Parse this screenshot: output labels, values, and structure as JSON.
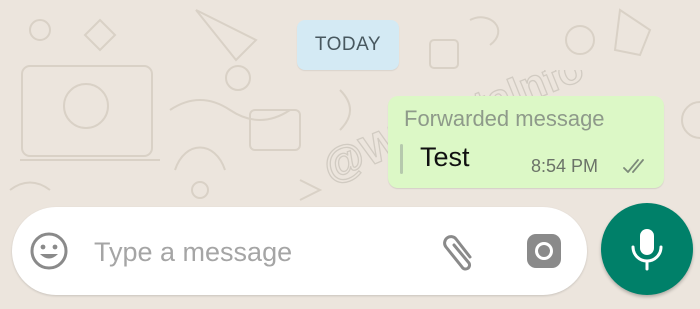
{
  "chat": {
    "date_divider": "TODAY",
    "message": {
      "forwarded_label": "Forwarded message",
      "text": "Test",
      "time": "8:54 PM",
      "status": "sent-double-tick"
    }
  },
  "composer": {
    "placeholder": "Type a message",
    "value": "",
    "icons": {
      "left": "emoji-icon",
      "attach": "paperclip-icon",
      "camera": "camera-icon",
      "send": "microphone-icon"
    }
  },
  "watermark": "@WABetaInfo",
  "colors": {
    "wallpaper": "#ece5dd",
    "outgoing_bubble": "#dcf8c6",
    "date_chip": "#d4eaf4",
    "accent": "#008069",
    "input_background": "#ffffff"
  }
}
